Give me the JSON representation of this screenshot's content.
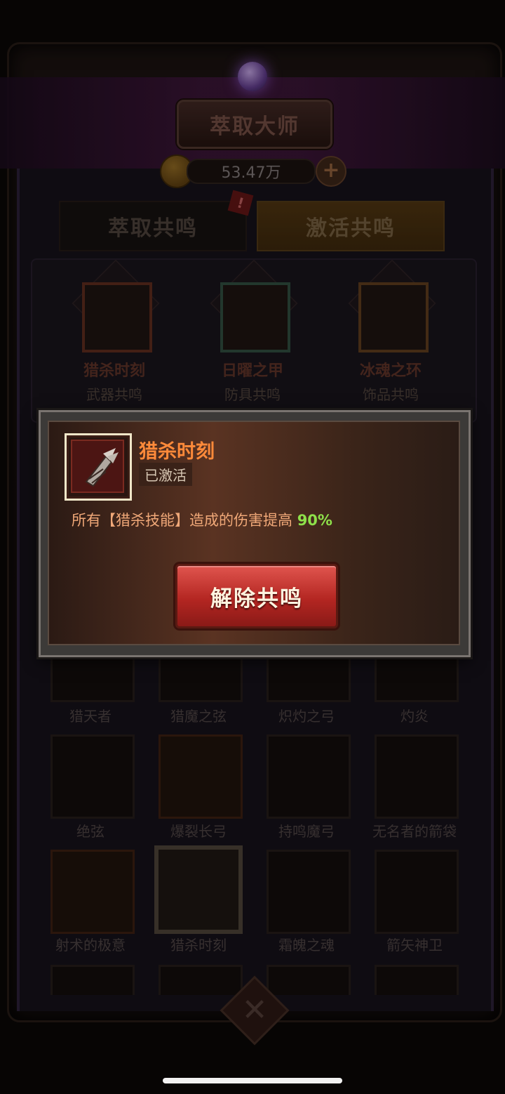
{
  "header": {
    "title": "萃取大师",
    "currency_value": "53.47万"
  },
  "tabs": [
    {
      "label": "萃取共鸣"
    },
    {
      "label": "激活共鸣"
    }
  ],
  "resonances": [
    {
      "name": "猎杀时刻",
      "type": "武器共鸣",
      "color": "#5a2a1c"
    },
    {
      "name": "日曜之甲",
      "type": "防具共鸣",
      "color": "#2e4a3c"
    },
    {
      "name": "冰魂之环",
      "type": "饰品共鸣",
      "color": "#5a3a1c"
    }
  ],
  "grid": {
    "row1": [
      "猎天者",
      "猎魔之弦",
      "炽灼之弓",
      "灼炎"
    ],
    "row2": [
      "绝弦",
      "爆裂长弓",
      "持鸣魔弓",
      "无名者的箭袋"
    ],
    "row3": [
      "射术的极意",
      "猎杀时刻",
      "霜魄之魂",
      "箭矢神卫"
    ]
  },
  "popup": {
    "title": "猎杀时刻",
    "status": "已激活",
    "desc_prefix": "所有【猎杀技能】造成的伤害提高 ",
    "desc_value": "90%",
    "button_label": "解除共鸣"
  },
  "colors": {
    "title_orange": "#ff8a3a",
    "value_green": "#8ee04a",
    "button_red": "#b42622"
  },
  "icons": {
    "tab_alert": "!",
    "add": "+",
    "close": "✕"
  }
}
